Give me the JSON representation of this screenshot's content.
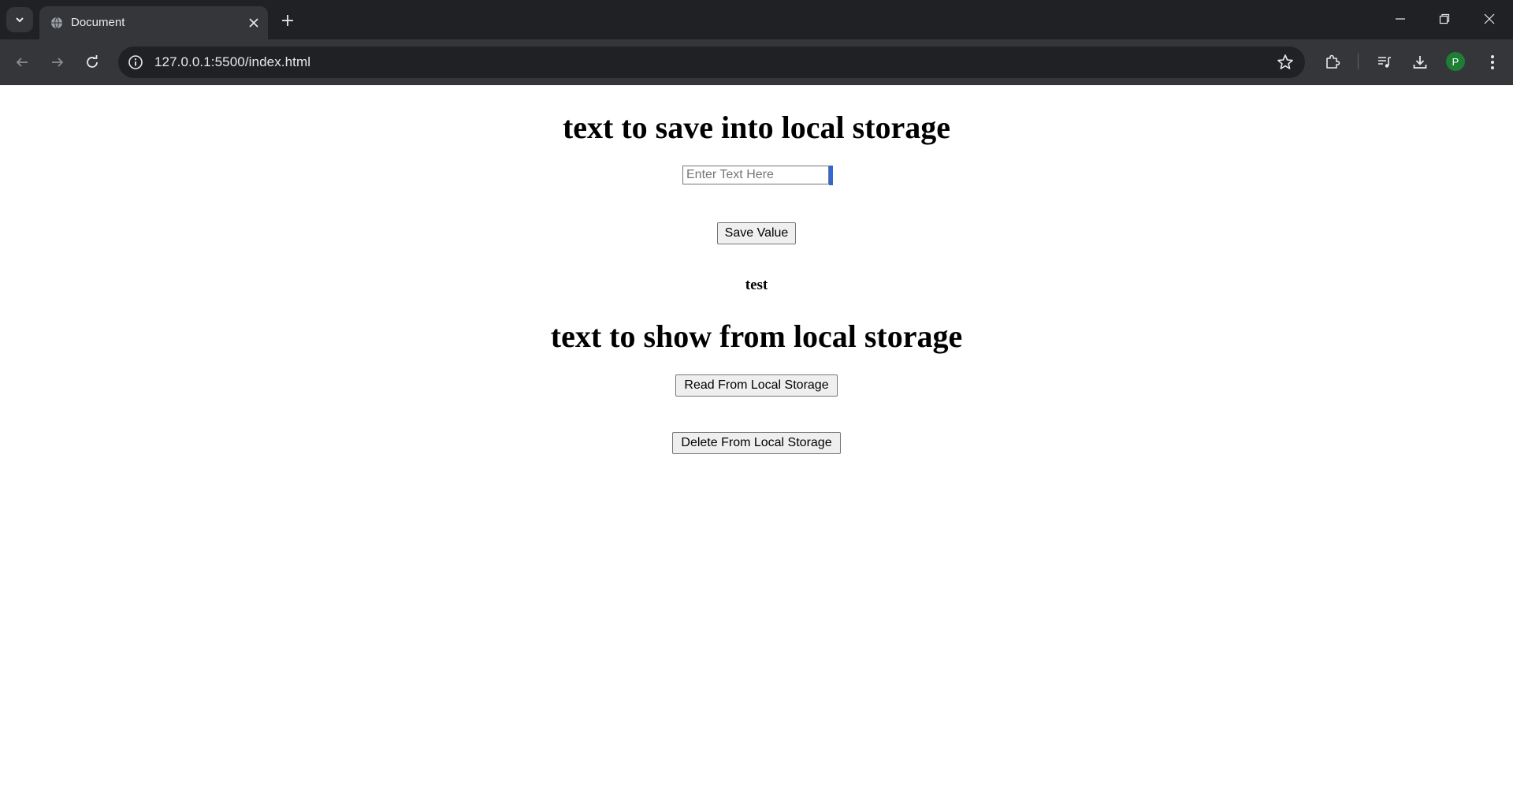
{
  "browser": {
    "tab_title": "Document",
    "url": "127.0.0.1:5500/index.html",
    "profile_initial": "P"
  },
  "page": {
    "save_heading": "text to save into local storage",
    "input": {
      "placeholder": "Enter Text Here",
      "value": ""
    },
    "save_button_label": "Save Value",
    "stored_text": "test",
    "show_heading": "text to show from local storage",
    "read_button_label": "Read From Local Storage",
    "delete_button_label": "Delete From Local Storage"
  },
  "colors": {
    "titlebar_bg": "#202124",
    "toolbar_bg": "#35363a",
    "focus_accent": "#3367d6",
    "avatar_bg": "#1e7e34"
  }
}
